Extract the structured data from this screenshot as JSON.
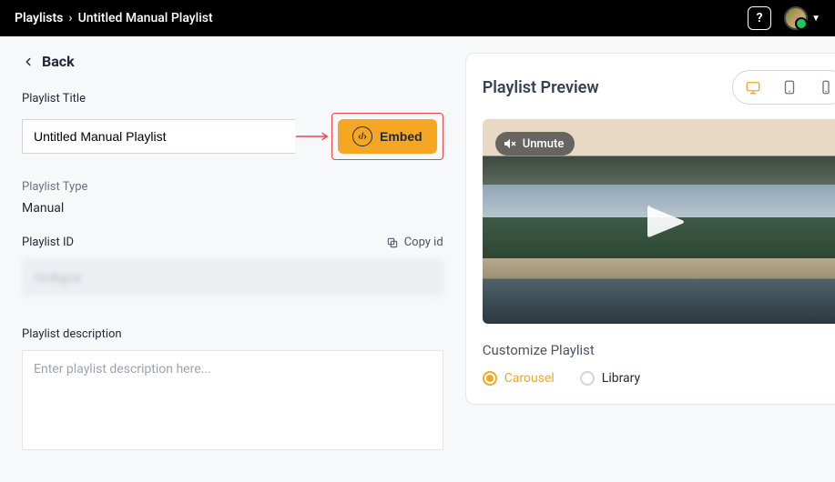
{
  "breadcrumb": {
    "root": "Playlists",
    "sep": "›",
    "current": "Untitled Manual Playlist"
  },
  "help": {
    "label": "?"
  },
  "back": {
    "label": "Back"
  },
  "playlist_title": {
    "label": "Playlist Title",
    "value": "Untitled Manual Playlist"
  },
  "embed": {
    "label": "Embed",
    "icon_glyph": "‹/›"
  },
  "playlist_type": {
    "label": "Playlist Type",
    "value": "Manual"
  },
  "playlist_id": {
    "label": "Playlist ID",
    "copy_label": "Copy id",
    "value": "txvkgcs"
  },
  "description": {
    "label": "Playlist description",
    "placeholder": "Enter playlist description here..."
  },
  "preview": {
    "title": "Playlist Preview",
    "devices": [
      {
        "key": "desktop",
        "active": true
      },
      {
        "key": "tablet",
        "active": false
      },
      {
        "key": "mobile",
        "active": false
      }
    ],
    "unmute_label": "Unmute"
  },
  "customize": {
    "title": "Customize Playlist",
    "options": [
      {
        "label": "Carousel",
        "selected": true
      },
      {
        "label": "Library",
        "selected": false
      }
    ]
  }
}
